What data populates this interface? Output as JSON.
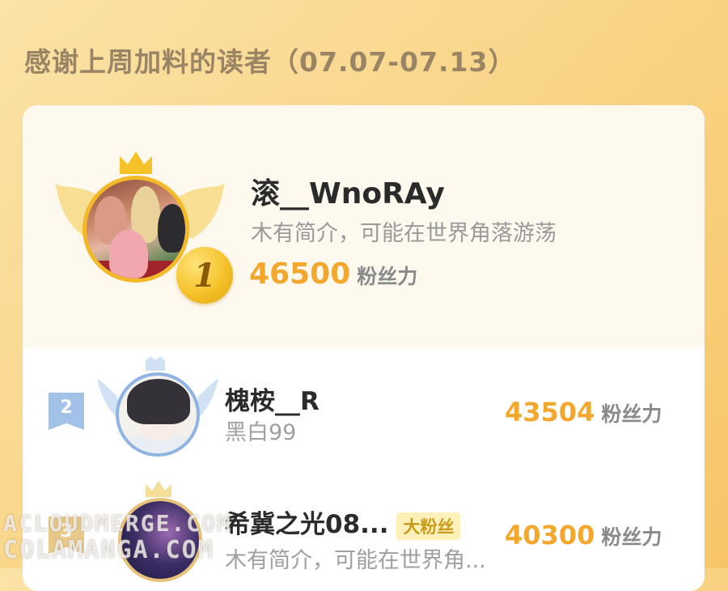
{
  "header": {
    "title": "感谢上周加料的读者（07.07-07.13）"
  },
  "colors": {
    "accent": "#f3a72c",
    "gold_badge": "#f5c22a",
    "silver_badge": "#a3c2e8",
    "tag_bg": "#fdf0b8"
  },
  "ranks": [
    {
      "rank": "1",
      "name": "滚__WnoRAy",
      "desc": "木有简介，可能在世界角落游荡",
      "score": "46500",
      "unit": "粉丝力"
    },
    {
      "rank": "2",
      "name": "槐桉__R",
      "desc": "黑白99",
      "score": "43504",
      "unit": "粉丝力"
    },
    {
      "rank": "3",
      "name": "希冀之光08...",
      "tag": "大粉丝",
      "desc": "木有简介，可能在世界角...",
      "score": "40300",
      "unit": "粉丝力"
    }
  ],
  "watermark": {
    "line1": "ACLOUDMERGE.COM",
    "line2": "COLAMANGA.COM"
  }
}
